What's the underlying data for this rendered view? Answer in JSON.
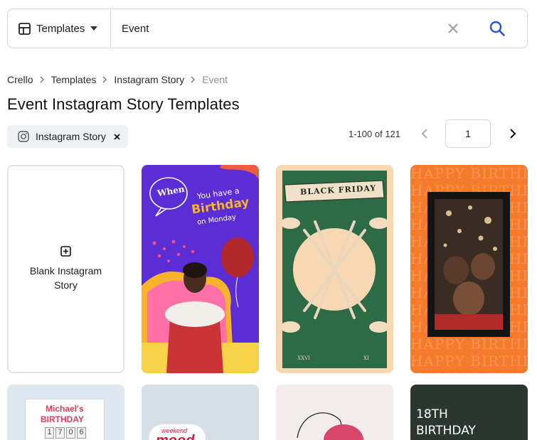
{
  "search": {
    "category_label": "Templates",
    "query": "Event"
  },
  "breadcrumb": [
    "Crello",
    "Templates",
    "Instagram Story",
    "Event"
  ],
  "page_title": "Event Instagram Story Templates",
  "filter_chip": {
    "label": "Instagram Story"
  },
  "pagination": {
    "range": "1-100 of 121",
    "page": "1"
  },
  "blank_card": {
    "label": "Blank Instagram Story"
  },
  "templates": [
    {
      "texts": [
        "When",
        "You have a",
        "Birthday",
        "on Monday"
      ]
    },
    {
      "texts": [
        "BLACK FRIDAY",
        "XXVI",
        "XI"
      ]
    },
    {
      "texts": [
        "HAPPY BIRTHDAY"
      ]
    }
  ],
  "templates_row2": [
    {
      "texts": [
        "Michael's",
        "BIRTHDAY",
        "1",
        "7",
        "0",
        "6"
      ]
    },
    {
      "texts": [
        "weekend",
        "mood"
      ]
    },
    {
      "texts": []
    },
    {
      "texts": [
        "18TH",
        "BIRTHDAY"
      ]
    }
  ],
  "colors": {
    "accent_blue": "#2a50d6",
    "card1_bg": "#5b2dd4",
    "card2_bg": "#f7d8b3",
    "card2_panel": "#2c6b46",
    "card3_bg": "#f47a2c"
  }
}
